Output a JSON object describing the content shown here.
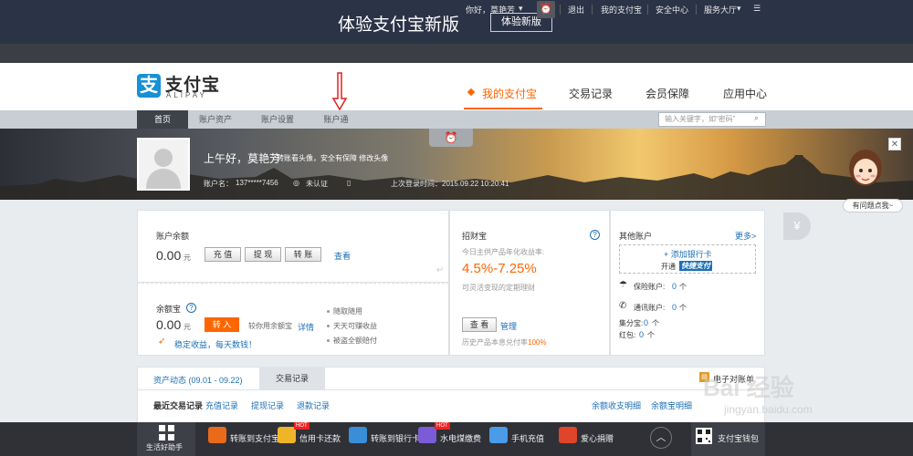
{
  "banner": {
    "title": "体验支付宝新版",
    "button": "体验新版"
  },
  "userbar": {
    "greeting": "你好，",
    "user_name": "莫艳芳",
    "logout": "退出",
    "my_alipay": "我的支付宝",
    "security": "安全中心",
    "service_hall": "服务大厅"
  },
  "header": {
    "logo_cn": "支付宝",
    "logo_en": "ALIPAY",
    "nav": [
      "我的支付宝",
      "交易记录",
      "会员保障",
      "应用中心"
    ]
  },
  "subnav": {
    "items": [
      "首页",
      "账户资产",
      "账户设置",
      "账户通"
    ],
    "search_placeholder": "输入关键字，如“密码”"
  },
  "hero": {
    "greeting": "上午好，莫艳芳",
    "greeting_sub": "转账看头像，安全有保障 修改头像",
    "account_label": "账户名：",
    "account_value": "137*****7456",
    "unverified": "未认证",
    "last_login": "上次登录时间：2015.09.22 10:20:41"
  },
  "balance": {
    "title": "账户余额",
    "amount": "0.00",
    "unit": "元",
    "recharge": "充 值",
    "withdraw": "提 现",
    "transfer": "转 账",
    "view": "查看"
  },
  "yuebao": {
    "title": "余额宝",
    "amount": "0.00",
    "unit": "元",
    "transfer_in": "转 入",
    "compare_text": "较你用余额宝",
    "detail": "详情",
    "promo": "稳定收益，每天数钱！",
    "features": [
      "随取随用",
      "天天可赚收益",
      "被盗全额赔付"
    ]
  },
  "zhaocaibao": {
    "title": "招财宝",
    "rate_label": "今日主供产品年化收益率:",
    "rate_low": "4.5%",
    "rate_sep": "-",
    "rate_high": "7.25%",
    "rate_note": "可灵活变现的定期理财",
    "view": "查 看",
    "manage": "管理",
    "history": "历史产品本息兑付率",
    "history_rate": "100%"
  },
  "other": {
    "title": "其他账户",
    "more": "更多>",
    "add_card": "+ 添加银行卡",
    "quickpay_prefix": "开通",
    "quickpay_badge": "快捷支付",
    "insurance_label": "保险账户:",
    "insurance_count": "0",
    "comm_label": "通讯账户:",
    "comm_count": "0",
    "jifenbao_label": "集分宝:",
    "jifenbao_count": "0",
    "hongbao_label": "红包:",
    "hongbao_count": "0",
    "unit": "个"
  },
  "records": {
    "tab_dynamic": "资产动态 (09.01 - 09.22)",
    "tab_trade": "交易记录",
    "ebill": "电子对账单",
    "links": [
      "最近交易记录",
      "充值记录",
      "提现记录",
      "退款记录"
    ],
    "right_links": [
      "余额收支明细",
      "余额宝明细"
    ]
  },
  "bottombar": {
    "first": "生活好助手",
    "items": [
      "转账到支付宝",
      "信用卡还款",
      "转账到银行卡",
      "水电煤缴费",
      "手机充值",
      "爱心捐赠"
    ],
    "hot": "HOT",
    "wallet": "支付宝钱包"
  },
  "side": {
    "help": "有问题点我~",
    "coin": "¥"
  },
  "watermark": {
    "main": "Bai 经验",
    "url": "jingyan.baidu.com"
  },
  "colors": {
    "accent": "#ff6600",
    "link": "#1c6fb5",
    "banner": "#2b3347",
    "rate": "#ff6600"
  }
}
